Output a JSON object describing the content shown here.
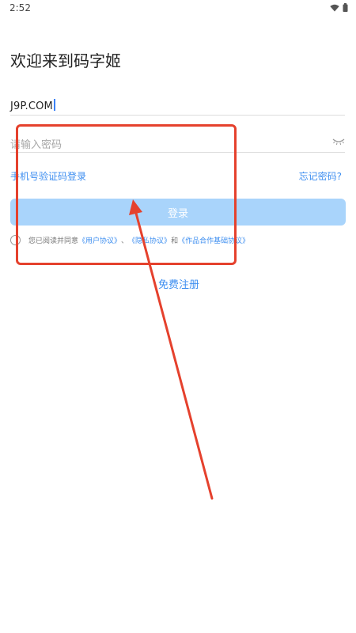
{
  "status_bar": {
    "time": "2:52",
    "icons": [
      "wifi-icon",
      "battery-icon"
    ]
  },
  "welcome_title": "欢迎来到码字姬",
  "account_field": {
    "value": "J9P.COM"
  },
  "password_field": {
    "placeholder": "请输入密码",
    "icon": "eye-closed-icon"
  },
  "sms_login_link": "手机号验证码登录",
  "forgot_password_link": "忘记密码?",
  "login_button": "登录",
  "agreement": {
    "prefix": "您已阅读并同意",
    "user_agreement": "《用户协议》",
    "sep1": "、",
    "privacy_agreement": "《隐私协议》",
    "sep2": "和",
    "works_agreement": "《作品合作基础协议》"
  },
  "register_link": "免费注册",
  "colors": {
    "accent": "#3d8ef0",
    "button": "#a9d4fb",
    "annotation": "#e5412d"
  }
}
